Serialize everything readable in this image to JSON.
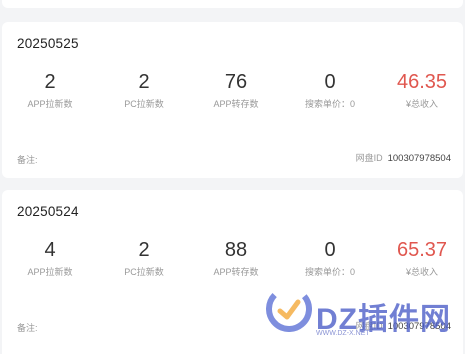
{
  "records": [
    {
      "date": "20250525",
      "app_new": {
        "value": "2",
        "label": "APP拉新数"
      },
      "pc_new": {
        "value": "2",
        "label": "PC拉新数"
      },
      "app_save": {
        "value": "76",
        "label": "APP转存数"
      },
      "search_price": {
        "value": "0",
        "label": "搜索单价：0"
      },
      "total_income": {
        "value": "46.35",
        "label": "¥总收入"
      },
      "remark_label": "备注:",
      "pan_label": "网盘ID",
      "pan_id": "100307978504"
    },
    {
      "date": "20250524",
      "app_new": {
        "value": "4",
        "label": "APP拉新数"
      },
      "pc_new": {
        "value": "2",
        "label": "PC拉新数"
      },
      "app_save": {
        "value": "88",
        "label": "APP转存数"
      },
      "search_price": {
        "value": "0",
        "label": "搜索单价：0"
      },
      "total_income": {
        "value": "65.37",
        "label": "¥总收入"
      },
      "remark_label": "备注:",
      "pan_label": "网盘ID",
      "pan_id": "100307978504"
    }
  ],
  "colors": {
    "income": "#e0574f",
    "label": "#999999",
    "page_bg": "#f3f4f6",
    "card_bg": "#ffffff"
  },
  "watermark": {
    "text": "DZ插件网",
    "subtext": "WWW.DZ-X.NET",
    "icon": "dz-logo-icon"
  }
}
